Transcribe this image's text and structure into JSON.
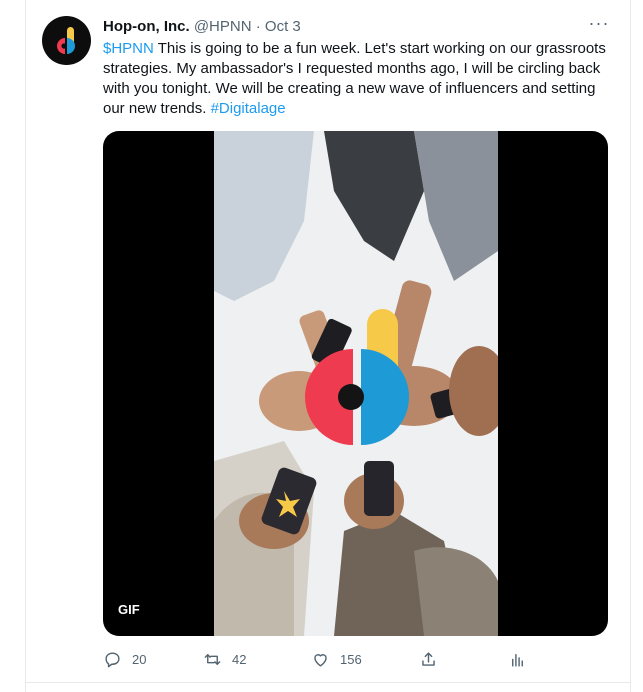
{
  "tweet": {
    "author_name": "Hop-on, Inc.",
    "handle": "@HPNN",
    "separator": "·",
    "date": "Oct 3",
    "more_label": "···",
    "text_cashtag": "$HPNN",
    "text_body": " This is going to be a fun week. Let's start working on our grassroots strategies. My ambassador's I requested months ago, I will be circling back with you tonight. We will be creating a new wave of influencers and setting our new trends. ",
    "text_hashtag": "#Digitalage"
  },
  "media": {
    "badge": "GIF"
  },
  "actions": {
    "reply_count": "20",
    "retweet_count": "42",
    "like_count": "156"
  },
  "colors": {
    "link": "#1d9bf0",
    "secondary_text": "#536471",
    "logo_red": "#ef3b4f",
    "logo_yellow": "#f7c948",
    "logo_blue": "#1e9ad6"
  },
  "icons": [
    "hop-on-logo-icon",
    "more-icon",
    "reply-icon",
    "retweet-icon",
    "like-icon",
    "share-icon",
    "analytics-icon"
  ]
}
